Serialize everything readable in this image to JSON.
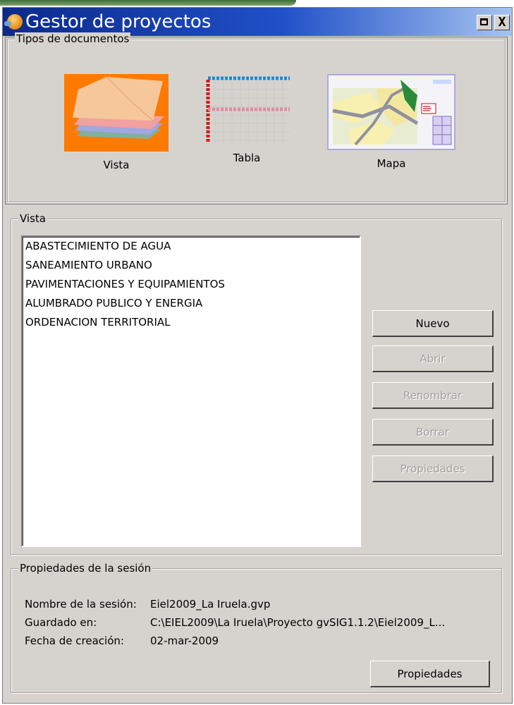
{
  "window": {
    "title": "Gestor de proyectos",
    "maximize_glyph": "",
    "close_glyph": "X"
  },
  "document_types": {
    "legend": "Tipos de documentos",
    "items": [
      {
        "label": "Vista",
        "icon": "vista-layers-icon"
      },
      {
        "label": "Tabla",
        "icon": "table-grid-icon"
      },
      {
        "label": "Mapa",
        "icon": "map-layout-icon"
      }
    ]
  },
  "vista_panel": {
    "legend": "Vista",
    "items": [
      "ABASTECIMIENTO DE AGUA",
      "SANEAMIENTO URBANO",
      "PAVIMENTACIONES Y EQUIPAMIENTOS",
      "ALUMBRADO PUBLICO Y ENERGIA",
      "ORDENACION TERRITORIAL"
    ],
    "buttons": {
      "nuevo": "Nuevo",
      "abrir": "Abrir",
      "renombrar": "Renombrar",
      "borrar": "Borrar",
      "propiedades": "Propiedades"
    }
  },
  "session": {
    "legend": "Propiedades de la sesión",
    "name_label": "Nombre de la sesión:",
    "name_value": "Eiel2009_La Iruela.gvp",
    "saved_label": "Guardado en:",
    "saved_value": "C:\\EIEL2009\\La Iruela\\Proyecto gvSIG1.1.2\\Eiel2009_L...",
    "created_label": "Fecha de creación:",
    "created_value": "02-mar-2009",
    "properties_button": "Propiedades"
  },
  "colors": {
    "titlebar_start": "#0c2a8a",
    "titlebar_end": "#a6c4f0",
    "dialog_bg": "#d6d3ce"
  }
}
